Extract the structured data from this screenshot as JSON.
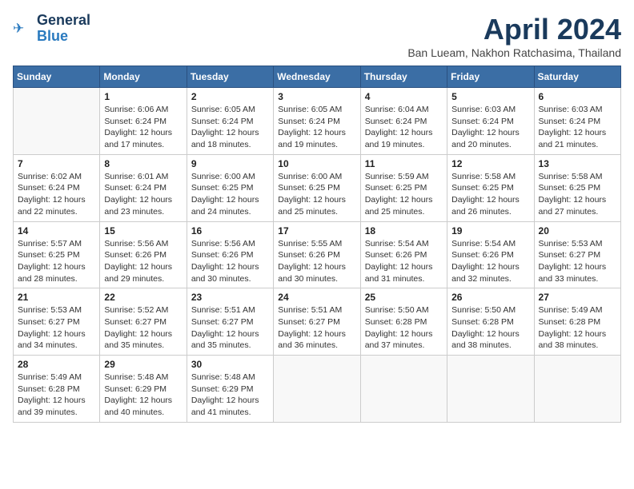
{
  "header": {
    "logo_general": "General",
    "logo_blue": "Blue",
    "month_title": "April 2024",
    "location": "Ban Lueam, Nakhon Ratchasima, Thailand"
  },
  "weekdays": [
    "Sunday",
    "Monday",
    "Tuesday",
    "Wednesday",
    "Thursday",
    "Friday",
    "Saturday"
  ],
  "weeks": [
    [
      {
        "day": "",
        "text": ""
      },
      {
        "day": "1",
        "text": "Sunrise: 6:06 AM\nSunset: 6:24 PM\nDaylight: 12 hours\nand 17 minutes."
      },
      {
        "day": "2",
        "text": "Sunrise: 6:05 AM\nSunset: 6:24 PM\nDaylight: 12 hours\nand 18 minutes."
      },
      {
        "day": "3",
        "text": "Sunrise: 6:05 AM\nSunset: 6:24 PM\nDaylight: 12 hours\nand 19 minutes."
      },
      {
        "day": "4",
        "text": "Sunrise: 6:04 AM\nSunset: 6:24 PM\nDaylight: 12 hours\nand 19 minutes."
      },
      {
        "day": "5",
        "text": "Sunrise: 6:03 AM\nSunset: 6:24 PM\nDaylight: 12 hours\nand 20 minutes."
      },
      {
        "day": "6",
        "text": "Sunrise: 6:03 AM\nSunset: 6:24 PM\nDaylight: 12 hours\nand 21 minutes."
      }
    ],
    [
      {
        "day": "7",
        "text": "Sunrise: 6:02 AM\nSunset: 6:24 PM\nDaylight: 12 hours\nand 22 minutes."
      },
      {
        "day": "8",
        "text": "Sunrise: 6:01 AM\nSunset: 6:24 PM\nDaylight: 12 hours\nand 23 minutes."
      },
      {
        "day": "9",
        "text": "Sunrise: 6:00 AM\nSunset: 6:25 PM\nDaylight: 12 hours\nand 24 minutes."
      },
      {
        "day": "10",
        "text": "Sunrise: 6:00 AM\nSunset: 6:25 PM\nDaylight: 12 hours\nand 25 minutes."
      },
      {
        "day": "11",
        "text": "Sunrise: 5:59 AM\nSunset: 6:25 PM\nDaylight: 12 hours\nand 25 minutes."
      },
      {
        "day": "12",
        "text": "Sunrise: 5:58 AM\nSunset: 6:25 PM\nDaylight: 12 hours\nand 26 minutes."
      },
      {
        "day": "13",
        "text": "Sunrise: 5:58 AM\nSunset: 6:25 PM\nDaylight: 12 hours\nand 27 minutes."
      }
    ],
    [
      {
        "day": "14",
        "text": "Sunrise: 5:57 AM\nSunset: 6:25 PM\nDaylight: 12 hours\nand 28 minutes."
      },
      {
        "day": "15",
        "text": "Sunrise: 5:56 AM\nSunset: 6:26 PM\nDaylight: 12 hours\nand 29 minutes."
      },
      {
        "day": "16",
        "text": "Sunrise: 5:56 AM\nSunset: 6:26 PM\nDaylight: 12 hours\nand 30 minutes."
      },
      {
        "day": "17",
        "text": "Sunrise: 5:55 AM\nSunset: 6:26 PM\nDaylight: 12 hours\nand 30 minutes."
      },
      {
        "day": "18",
        "text": "Sunrise: 5:54 AM\nSunset: 6:26 PM\nDaylight: 12 hours\nand 31 minutes."
      },
      {
        "day": "19",
        "text": "Sunrise: 5:54 AM\nSunset: 6:26 PM\nDaylight: 12 hours\nand 32 minutes."
      },
      {
        "day": "20",
        "text": "Sunrise: 5:53 AM\nSunset: 6:27 PM\nDaylight: 12 hours\nand 33 minutes."
      }
    ],
    [
      {
        "day": "21",
        "text": "Sunrise: 5:53 AM\nSunset: 6:27 PM\nDaylight: 12 hours\nand 34 minutes."
      },
      {
        "day": "22",
        "text": "Sunrise: 5:52 AM\nSunset: 6:27 PM\nDaylight: 12 hours\nand 35 minutes."
      },
      {
        "day": "23",
        "text": "Sunrise: 5:51 AM\nSunset: 6:27 PM\nDaylight: 12 hours\nand 35 minutes."
      },
      {
        "day": "24",
        "text": "Sunrise: 5:51 AM\nSunset: 6:27 PM\nDaylight: 12 hours\nand 36 minutes."
      },
      {
        "day": "25",
        "text": "Sunrise: 5:50 AM\nSunset: 6:28 PM\nDaylight: 12 hours\nand 37 minutes."
      },
      {
        "day": "26",
        "text": "Sunrise: 5:50 AM\nSunset: 6:28 PM\nDaylight: 12 hours\nand 38 minutes."
      },
      {
        "day": "27",
        "text": "Sunrise: 5:49 AM\nSunset: 6:28 PM\nDaylight: 12 hours\nand 38 minutes."
      }
    ],
    [
      {
        "day": "28",
        "text": "Sunrise: 5:49 AM\nSunset: 6:28 PM\nDaylight: 12 hours\nand 39 minutes."
      },
      {
        "day": "29",
        "text": "Sunrise: 5:48 AM\nSunset: 6:29 PM\nDaylight: 12 hours\nand 40 minutes."
      },
      {
        "day": "30",
        "text": "Sunrise: 5:48 AM\nSunset: 6:29 PM\nDaylight: 12 hours\nand 41 minutes."
      },
      {
        "day": "",
        "text": ""
      },
      {
        "day": "",
        "text": ""
      },
      {
        "day": "",
        "text": ""
      },
      {
        "day": "",
        "text": ""
      }
    ]
  ]
}
